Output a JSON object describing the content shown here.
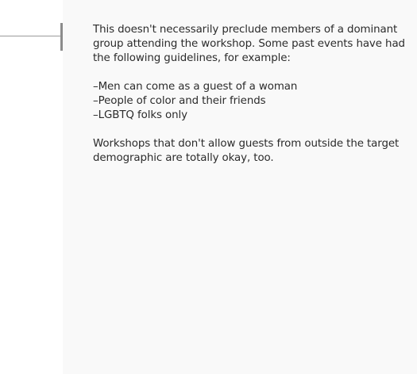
{
  "article": {
    "intro": "This doesn't necessarily preclude members of a dominant group attending the workshop. Some past events have had the following guidelines, for example:",
    "guidelines": [
      "–Men can come as a guest of a woman",
      "–People of color and their friends",
      "–LGBTQ folks only"
    ],
    "closing": "Workshops that don't allow guests from outside the target demographic are totally okay, too."
  },
  "colors": {
    "panel_background": "#f9f9f9",
    "text": "#2b2b2b",
    "gutter_bar": "#8c8c8c"
  }
}
